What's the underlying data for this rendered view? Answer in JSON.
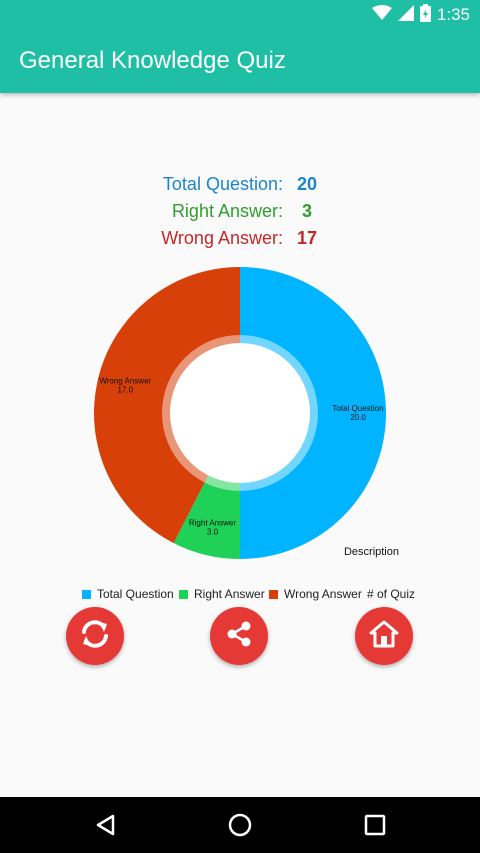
{
  "status_bar": {
    "time": "1:35",
    "icons": [
      "wifi-icon",
      "signal-icon",
      "battery-icon"
    ]
  },
  "app_bar": {
    "title": "General Knowledge Quiz"
  },
  "stats": [
    {
      "label": "Total Question:",
      "value": "20",
      "color": "#1a86c8"
    },
    {
      "label": "Right Answer:",
      "value": "3",
      "color": "#2f9e2f"
    },
    {
      "label": "Wrong Answer:",
      "value": "17",
      "color": "#c62828"
    }
  ],
  "chart_data": {
    "type": "pie",
    "subtype": "donut",
    "categories": [
      "Total Question",
      "Right Answer",
      "Wrong Answer"
    ],
    "values": [
      20.0,
      3.0,
      17.0
    ],
    "slice_labels": [
      "Total Question\n20.0",
      "Right Answer\n3.0",
      "Wrong Answer\n17.0"
    ],
    "colors": [
      "#00b4ff",
      "#1fd157",
      "#d8400a"
    ],
    "description": "Description",
    "legend": [
      "Total Question",
      "Right Answer",
      "Wrong Answer"
    ],
    "legend_extra": "# of Quiz",
    "legend_placement": "bottom"
  },
  "buttons": [
    {
      "name": "retry-button",
      "icon": "refresh-icon"
    },
    {
      "name": "share-button",
      "icon": "share-icon"
    },
    {
      "name": "home-button",
      "icon": "home-icon"
    }
  ],
  "nav_bar": {
    "icons": [
      "back-icon",
      "home-circle-icon",
      "recents-icon"
    ]
  }
}
